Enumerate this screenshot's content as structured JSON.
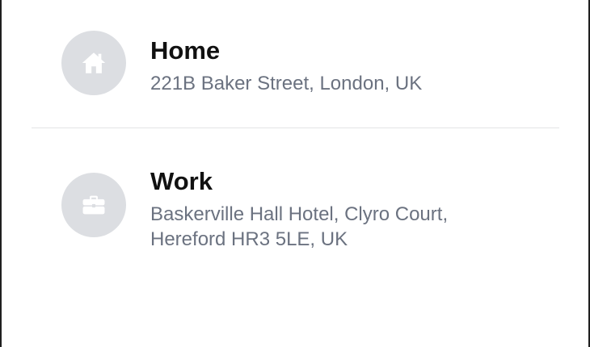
{
  "addresses": [
    {
      "title": "Home",
      "address": "221B Baker Street, London, UK",
      "icon": "home-icon"
    },
    {
      "title": "Work",
      "address": "Baskerville Hall Hotel, Clyro Court,\nHereford HR3 5LE, UK",
      "icon": "briefcase-icon"
    }
  ],
  "colors": {
    "avatar_bg": "#dcdee2",
    "icon": "#ffffff",
    "title": "#111111",
    "address": "#6b7280",
    "divider": "#e3e4e6"
  }
}
